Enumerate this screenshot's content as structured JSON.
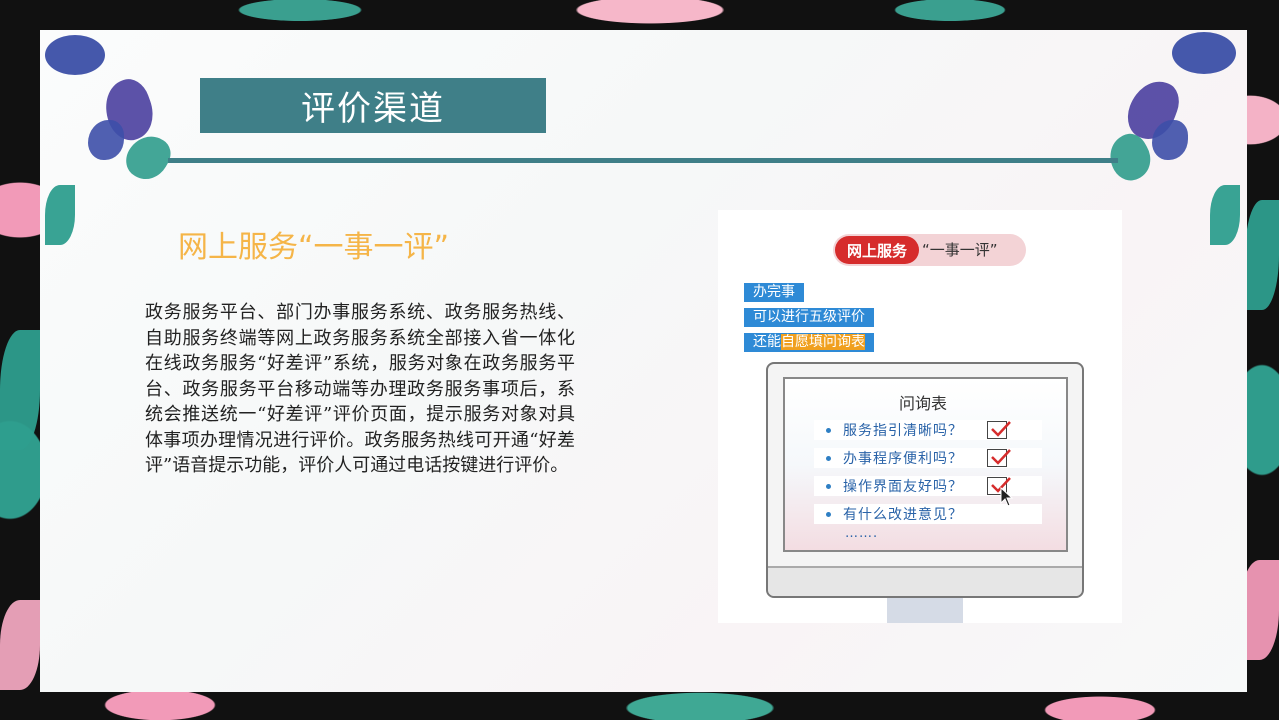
{
  "slide": {
    "title": "评价渠道",
    "subtitle": "网上服务“一事一评”",
    "body": "政务服务平台、部门办事服务系统、政务服务热线、自助服务终端等网上政务服务系统全部接入省一体化在线政务服务“好差评”系统，服务对象在政务服务平台、政务服务平台移动端等办理政务服务事项后，系统会推送统一“好差评”评价页面，提示服务对象对具体事项办理情况进行评价。政务服务热线可开通“好差评”语音提示功能，评价人可通过电话按键进行评价。"
  },
  "illustration": {
    "badge_red": "网上服务",
    "badge_text": "“一事一评”",
    "tags": [
      "办完事",
      "可以进行五级评价",
      "还能",
      "自愿填问询表"
    ],
    "questionnaire": {
      "title": "问询表",
      "items": [
        "服务指引清晰吗？",
        "办事程序便利吗？",
        "操作界面友好吗？",
        "有什么改进意见？"
      ],
      "more": "……."
    }
  },
  "colors": {
    "title_bg": "#3f7f88",
    "subtitle": "#f5b548",
    "badge_red": "#d62c2c",
    "tag_blue": "#2e8ad6",
    "tag_highlight": "#f0a020"
  }
}
